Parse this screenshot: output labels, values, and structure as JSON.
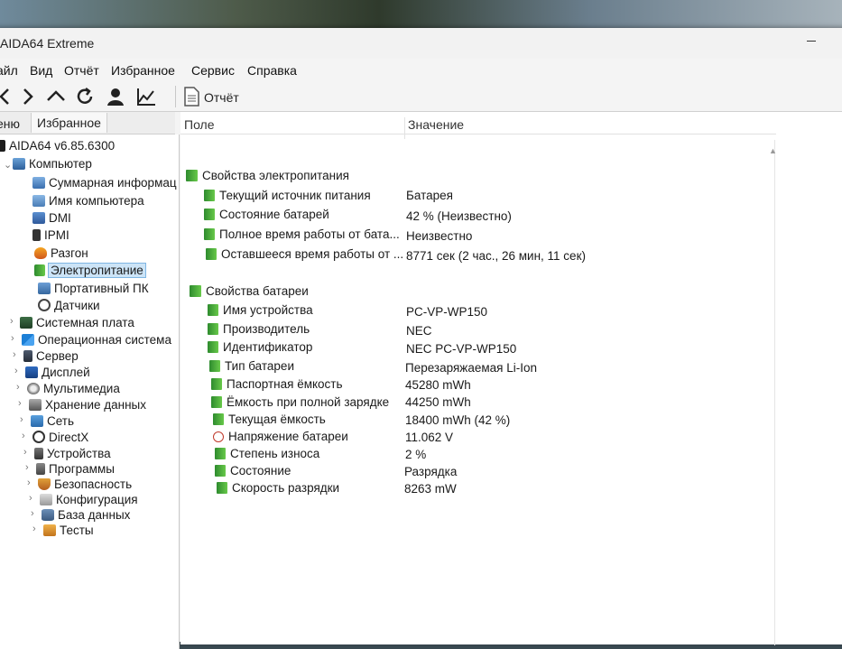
{
  "window": {
    "title": "AIDA64 Extreme"
  },
  "menu": [
    "айл",
    "Вид",
    "Отчёт",
    "Избранное",
    "Сервис",
    "Справка"
  ],
  "toolbar": {
    "report_label": "Отчёт"
  },
  "tabs": {
    "menu": "еню",
    "favorites": "Избранное"
  },
  "tree": {
    "root": "AIDA64 v6.85.6300",
    "computer": "Компьютер",
    "computer_children": [
      "Суммарная информац",
      "Имя компьютера",
      "DMI",
      "IPMI",
      "Разгон",
      "Электропитание",
      "Портативный ПК",
      "Датчики"
    ],
    "categories": [
      "Системная плата",
      "Операционная система",
      "Сервер",
      "Дисплей",
      "Мультимедиа",
      "Хранение данных",
      "Сеть",
      "DirectX",
      "Устройства",
      "Программы",
      "Безопасность",
      "Конфигурация",
      "База данных",
      "Тесты"
    ]
  },
  "list": {
    "col_field": "Поле",
    "col_value": "Значение",
    "group1": "Свойства электропитания",
    "group1_rows": [
      {
        "field": "Текущий источник питания",
        "value": "Батарея"
      },
      {
        "field": "Состояние батарей",
        "value": "42 % (Неизвестно)"
      },
      {
        "field": "Полное время работы от бата...",
        "value": "Неизвестно"
      },
      {
        "field": "Оставшееся время работы от ...",
        "value": "8771 сек (2 час., 26 мин, 11 сек)"
      }
    ],
    "group2": "Свойства батареи",
    "group2_rows": [
      {
        "field": "Имя устройства",
        "value": "PC-VP-WP150"
      },
      {
        "field": "Производитель",
        "value": "NEC"
      },
      {
        "field": "Идентификатор",
        "value": "NEC  PC-VP-WP150"
      },
      {
        "field": "Тип батареи",
        "value": "Перезаряжаемая Li-Ion"
      },
      {
        "field": "Паспортная ёмкость",
        "value": "45280 mWh"
      },
      {
        "field": "Ёмкость при полной зарядке",
        "value": "44250 mWh"
      },
      {
        "field": "Текущая ёмкость",
        "value": "18400 mWh  (42 %)"
      },
      {
        "field": "Напряжение батареи",
        "value": "11.062 V"
      },
      {
        "field": "Степень износа",
        "value": "2 %"
      },
      {
        "field": "Состояние",
        "value": "Разрядка"
      },
      {
        "field": "Скорость разрядки",
        "value": "8263 mW"
      }
    ]
  },
  "colors": {
    "selection": "#cce4f7",
    "battery_icon": "#3fa33f"
  }
}
